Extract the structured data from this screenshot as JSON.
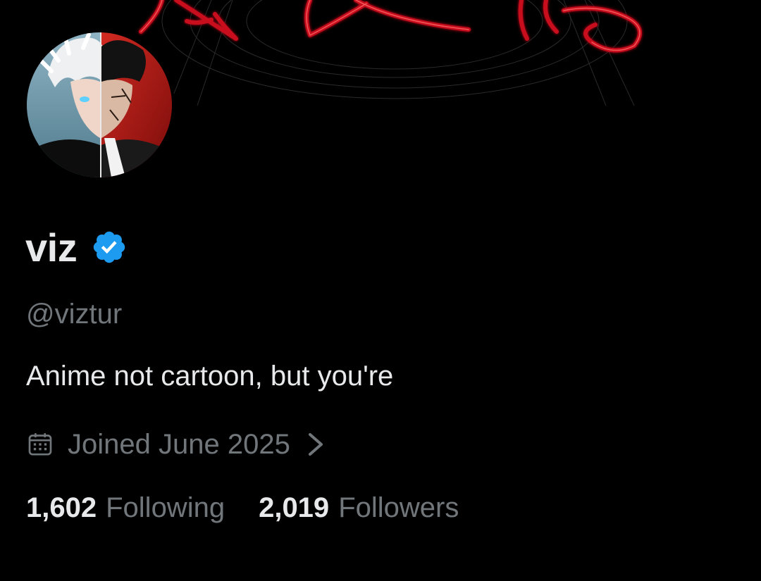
{
  "theme": {
    "background": "#000000",
    "text_primary": "#e7e9ea",
    "text_secondary": "#71767b",
    "verified_blue": "#1d9bf0",
    "banner_accent": "#c8101e"
  },
  "banner": {
    "icon": "red-calligraphy-banner-art"
  },
  "profile": {
    "avatar_icon": "anime-split-face-avatar",
    "display_name": "viz",
    "verified": true,
    "verified_icon": "verified-badge-icon",
    "handle": "@viztur",
    "bio": "Anime not cartoon, but you're",
    "joined": {
      "icon": "calendar-icon",
      "text": "Joined June 2025",
      "chevron_icon": "chevron-right-icon"
    }
  },
  "stats": {
    "following": {
      "count": "1,602",
      "label": "Following"
    },
    "followers": {
      "count": "2,019",
      "label": "Followers"
    }
  }
}
